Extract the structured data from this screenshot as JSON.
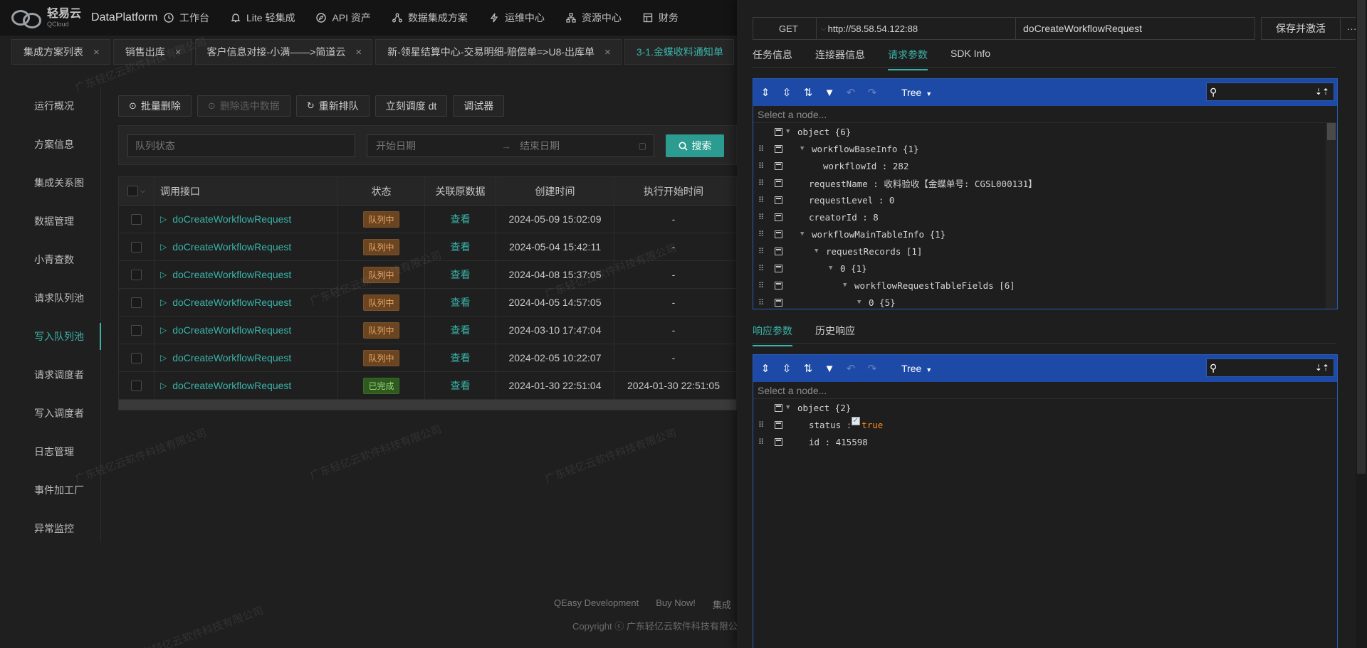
{
  "topbar": {
    "logo_cn": "轻易云",
    "logo_en": "QCloud",
    "product": "DataPlatform",
    "nav": [
      {
        "label": "工作台",
        "icon": "clock-icon"
      },
      {
        "label": "Lite 轻集成",
        "icon": "bell-icon"
      },
      {
        "label": "API 资产",
        "icon": "compass-icon"
      },
      {
        "label": "数据集成方案",
        "icon": "share-icon"
      },
      {
        "label": "运维中心",
        "icon": "lightning-icon"
      },
      {
        "label": "资源中心",
        "icon": "network-icon"
      },
      {
        "label": "财务",
        "icon": "table-icon"
      }
    ]
  },
  "tabs": [
    {
      "label": "集成方案列表",
      "active": false
    },
    {
      "label": "销售出库",
      "active": false
    },
    {
      "label": "客户信息对接-小满——>简道云",
      "active": false
    },
    {
      "label": "新-领星结算中心-交易明细-赔偿单=>U8-出库单",
      "active": false
    },
    {
      "label": "3-1.金蝶收料通知单",
      "active": true
    }
  ],
  "sidebar": {
    "items": [
      {
        "label": "运行概况",
        "active": false
      },
      {
        "label": "方案信息",
        "active": false
      },
      {
        "label": "集成关系图",
        "active": false
      },
      {
        "label": "数据管理",
        "active": false
      },
      {
        "label": "小青查数",
        "active": false
      },
      {
        "label": "请求队列池",
        "active": false
      },
      {
        "label": "写入队列池",
        "active": true
      },
      {
        "label": "请求调度者",
        "active": false
      },
      {
        "label": "写入调度者",
        "active": false
      },
      {
        "label": "日志管理",
        "active": false
      },
      {
        "label": "事件加工厂",
        "active": false
      },
      {
        "label": "异常监控",
        "active": false
      }
    ]
  },
  "toolbar": {
    "batch_delete": "批量删除",
    "delete_selected": "删除选中数据",
    "requeue": "重新排队",
    "dispatch_now": "立刻调度 dt",
    "debugger": "调试器"
  },
  "filter": {
    "status_placeholder": "队列状态",
    "start_placeholder": "开始日期",
    "end_placeholder": "结束日期",
    "search_label": "搜索"
  },
  "table": {
    "headers": [
      "调用接口",
      "状态",
      "关联原数据",
      "创建时间",
      "执行开始时间"
    ],
    "rows": [
      {
        "api": "doCreateWorkflowRequest",
        "status": "队列中",
        "status_type": "queue",
        "view": "查看",
        "created": "2024-05-09 15:02:09",
        "started": "-"
      },
      {
        "api": "doCreateWorkflowRequest",
        "status": "队列中",
        "status_type": "queue",
        "view": "查看",
        "created": "2024-05-04 15:42:11",
        "started": "-"
      },
      {
        "api": "doCreateWorkflowRequest",
        "status": "队列中",
        "status_type": "queue",
        "view": "查看",
        "created": "2024-04-08 15:37:05",
        "started": "-"
      },
      {
        "api": "doCreateWorkflowRequest",
        "status": "队列中",
        "status_type": "queue",
        "view": "查看",
        "created": "2024-04-05 14:57:05",
        "started": "-"
      },
      {
        "api": "doCreateWorkflowRequest",
        "status": "队列中",
        "status_type": "queue",
        "view": "查看",
        "created": "2024-03-10 17:47:04",
        "started": "-"
      },
      {
        "api": "doCreateWorkflowRequest",
        "status": "队列中",
        "status_type": "queue",
        "view": "查看",
        "created": "2024-02-05 10:22:07",
        "started": "-"
      },
      {
        "api": "doCreateWorkflowRequest",
        "status": "已完成",
        "status_type": "done",
        "view": "查看",
        "created": "2024-01-30 22:51:04",
        "started": "2024-01-30 22:51:05"
      }
    ]
  },
  "watermark": "广东轻亿云软件科技有限公司",
  "footer": {
    "links": [
      "QEasy Development",
      "Buy Now!",
      "集成"
    ],
    "copyright": "Copyright ⓒ 广东轻亿云软件科技有限公司"
  },
  "drawer": {
    "method": "GET",
    "url": "http://58.58.54.122:88",
    "api_name": "doCreateWorkflowRequest",
    "save_label": "保存并激活",
    "more_label": "···",
    "tabs": [
      {
        "label": "任务信息",
        "active": false
      },
      {
        "label": "连接器信息",
        "active": false
      },
      {
        "label": "请求参数",
        "active": true
      },
      {
        "label": "SDK Info",
        "active": false
      }
    ],
    "resp_tabs": [
      {
        "label": "响应参数",
        "active": true
      },
      {
        "label": "历史响应",
        "active": false
      }
    ],
    "editor_mode": "Tree",
    "node_placeholder": "Select a node...",
    "request_tree": [
      {
        "depth": 0,
        "expand": true,
        "drag": false,
        "text": "object {6}"
      },
      {
        "depth": 1,
        "expand": true,
        "drag": true,
        "text": "workflowBaseInfo {1}"
      },
      {
        "depth": 2,
        "expand": false,
        "drag": true,
        "text": "workflowId : 282"
      },
      {
        "depth": 1,
        "expand": false,
        "drag": true,
        "text": "requestName : 收料验收【金蝶单号: CGSL000131】"
      },
      {
        "depth": 1,
        "expand": false,
        "drag": true,
        "text": "requestLevel : 0"
      },
      {
        "depth": 1,
        "expand": false,
        "drag": true,
        "text": "creatorId : 8"
      },
      {
        "depth": 1,
        "expand": true,
        "drag": true,
        "text": "workflowMainTableInfo {1}"
      },
      {
        "depth": 2,
        "expand": true,
        "drag": true,
        "text": "requestRecords [1]"
      },
      {
        "depth": 3,
        "expand": true,
        "drag": true,
        "text": "0 {1}"
      },
      {
        "depth": 4,
        "expand": true,
        "drag": true,
        "text": "workflowRequestTableFields [6]"
      },
      {
        "depth": 5,
        "expand": true,
        "drag": true,
        "text": "0 {5}"
      }
    ],
    "response_tree": [
      {
        "depth": 0,
        "expand": true,
        "drag": false,
        "text": "object {2}"
      },
      {
        "depth": 1,
        "expand": false,
        "drag": true,
        "key": "status",
        "bool": "true"
      },
      {
        "depth": 1,
        "expand": false,
        "drag": true,
        "text": "id : 415598"
      }
    ]
  }
}
